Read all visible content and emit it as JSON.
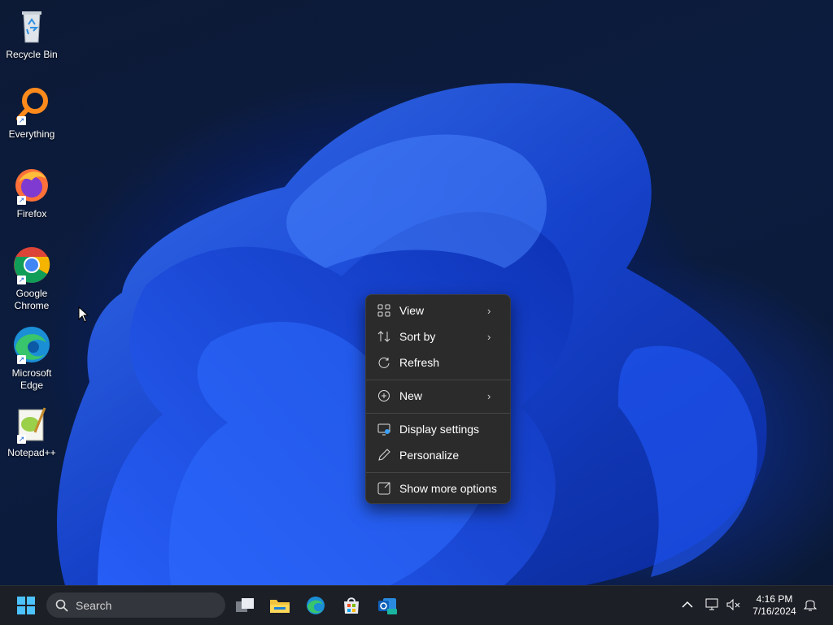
{
  "desktop": {
    "icons": [
      {
        "label": "Recycle Bin",
        "icon": "recycle-bin-icon"
      },
      {
        "label": "Everything",
        "icon": "everything-search-icon"
      },
      {
        "label": "Firefox",
        "icon": "firefox-icon"
      },
      {
        "label": "Google\nChrome",
        "icon": "chrome-icon"
      },
      {
        "label": "Microsoft\nEdge",
        "icon": "edge-icon"
      },
      {
        "label": "Notepad++",
        "icon": "notepadpp-icon"
      }
    ]
  },
  "context_menu": {
    "items": [
      {
        "label": "View",
        "icon": "view-grid-icon",
        "submenu": true
      },
      {
        "label": "Sort by",
        "icon": "sort-icon",
        "submenu": true
      },
      {
        "label": "Refresh",
        "icon": "refresh-icon",
        "submenu": false
      },
      {
        "label": "New",
        "icon": "new-plus-icon",
        "submenu": true
      },
      {
        "label": "Display settings",
        "icon": "display-settings-icon",
        "submenu": false
      },
      {
        "label": "Personalize",
        "icon": "pen-icon",
        "submenu": false
      },
      {
        "label": "Show more options",
        "icon": "more-options-icon",
        "submenu": false
      }
    ],
    "arrow_glyph": "›"
  },
  "taskbar": {
    "search_label": "Search",
    "pinned": [
      "start-icon",
      "task-view-icon",
      "file-explorer-icon",
      "edge-icon",
      "store-icon",
      "outlook-new-icon"
    ],
    "clock_time": "4:16 PM",
    "clock_date": "7/16/2024"
  },
  "colors": {
    "menu_bg": "#2b2b2b",
    "taskbar_bg": "#1c1f26",
    "accent": "#1a5fd1"
  }
}
